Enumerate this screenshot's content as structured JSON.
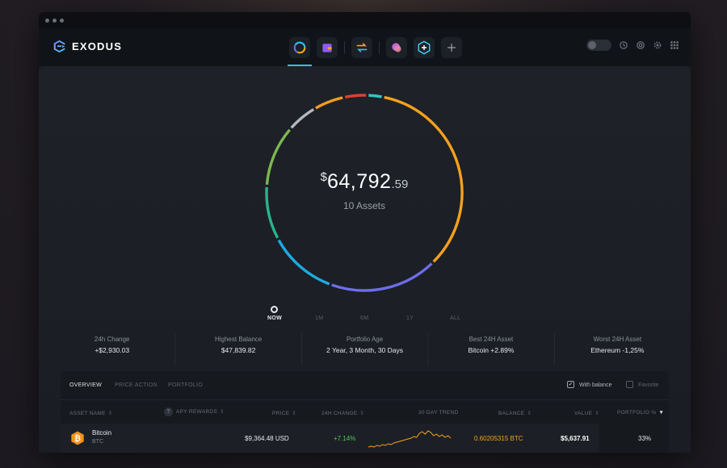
{
  "app": {
    "name": "EXODUS",
    "brand_colors": {
      "primary": "#8c7bff",
      "accent": "#2ec1f0"
    }
  },
  "nav": {
    "items": [
      {
        "name": "portfolio-icon",
        "active": true
      },
      {
        "name": "wallet-icon",
        "active": false
      },
      {
        "name": "exchange-icon",
        "active": false
      },
      {
        "name": "app-icon-1",
        "active": false
      },
      {
        "name": "app-icon-2",
        "active": false
      },
      {
        "name": "add-icon",
        "active": false
      }
    ]
  },
  "header_controls": [
    "lock-toggle",
    "history-icon",
    "support-icon",
    "settings-icon",
    "grid-icon"
  ],
  "portfolio": {
    "currency_symbol": "$",
    "total_int": "64,792",
    "total_dec": ".59",
    "assets_label": "10 Assets",
    "segments": [
      {
        "color": "#f7a11c",
        "value": 27
      },
      {
        "color": "#6c6ee8",
        "value": 14
      },
      {
        "color": "#1fa9e1",
        "value": 9
      },
      {
        "color": "#29b38f",
        "value": 7
      },
      {
        "color": "#7cb850",
        "value": 8
      },
      {
        "color": "#b4b8bf",
        "value": 4
      },
      {
        "color": "#f29d1e",
        "value": 4
      },
      {
        "color": "#e0402e",
        "value": 3
      },
      {
        "color": "#2fc6c6",
        "value": 2
      }
    ]
  },
  "ranges": [
    "NOW",
    "1M",
    "6M",
    "1Y",
    "ALL"
  ],
  "stats": [
    {
      "label": "24h Change",
      "value": "+$2,930.03"
    },
    {
      "label": "Highest Balance",
      "value": "$47,839.82"
    },
    {
      "label": "Portfolio Age",
      "value": "2 Year, 3 Month, 30 Days"
    },
    {
      "label": "Best 24H Asset",
      "value": "Bitcoin +2.89%"
    },
    {
      "label": "Worst 24H Asset",
      "value": "Ethereum -1,25%"
    }
  ],
  "table": {
    "tabs": [
      "OVERVIEW",
      "PRICE ACTION",
      "PORTFOLIO"
    ],
    "with_balance_label": "With balance",
    "favorite_label": "Favorite",
    "columns": {
      "asset": "ASSET NAME",
      "apy": "APY REWARDS",
      "price": "PRICE",
      "change": "24H CHANGE",
      "trend": "30 DAY TREND",
      "balance": "BALANCE",
      "value": "VALUE",
      "portfolio": "PORTFOLIO %"
    },
    "rows": [
      {
        "name": "Bitcoin",
        "ticker": "BTC",
        "price": "$9,364.48 USD",
        "change": "+7.14%",
        "balance": "0.60205315 BTC",
        "value": "$5,637.91",
        "portfolio": "33%",
        "trend": [
          3,
          4,
          3,
          5,
          4,
          6,
          5,
          7,
          6,
          8,
          9,
          10,
          11,
          12,
          13,
          14,
          16,
          15,
          20,
          22,
          19,
          23,
          21,
          17,
          19,
          16,
          18,
          15,
          17,
          14
        ]
      }
    ]
  }
}
